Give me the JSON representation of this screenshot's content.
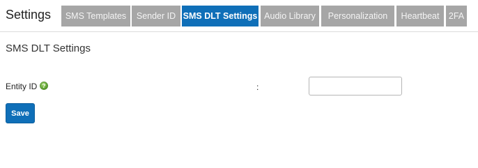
{
  "header": {
    "title": "Settings"
  },
  "tabs": [
    {
      "label": "SMS Templates",
      "active": false
    },
    {
      "label": "Sender ID",
      "active": false
    },
    {
      "label": "SMS DLT Settings",
      "active": true
    },
    {
      "label": "Audio Library",
      "active": false
    },
    {
      "label": "Personalization",
      "active": false
    },
    {
      "label": "Heartbeat",
      "active": false
    },
    {
      "label": "2FA",
      "active": false
    }
  ],
  "section": {
    "title": "SMS DLT Settings"
  },
  "form": {
    "entity_id_label": "Entity ID",
    "separator": ":",
    "entity_id_value": "",
    "help_icon": "question-circle-icon",
    "save_label": "Save"
  },
  "colors": {
    "active_tab": "#0f6fb8",
    "inactive_tab": "#a6a6a6",
    "help_icon": "#5aa02c",
    "button": "#0f6fb8"
  }
}
